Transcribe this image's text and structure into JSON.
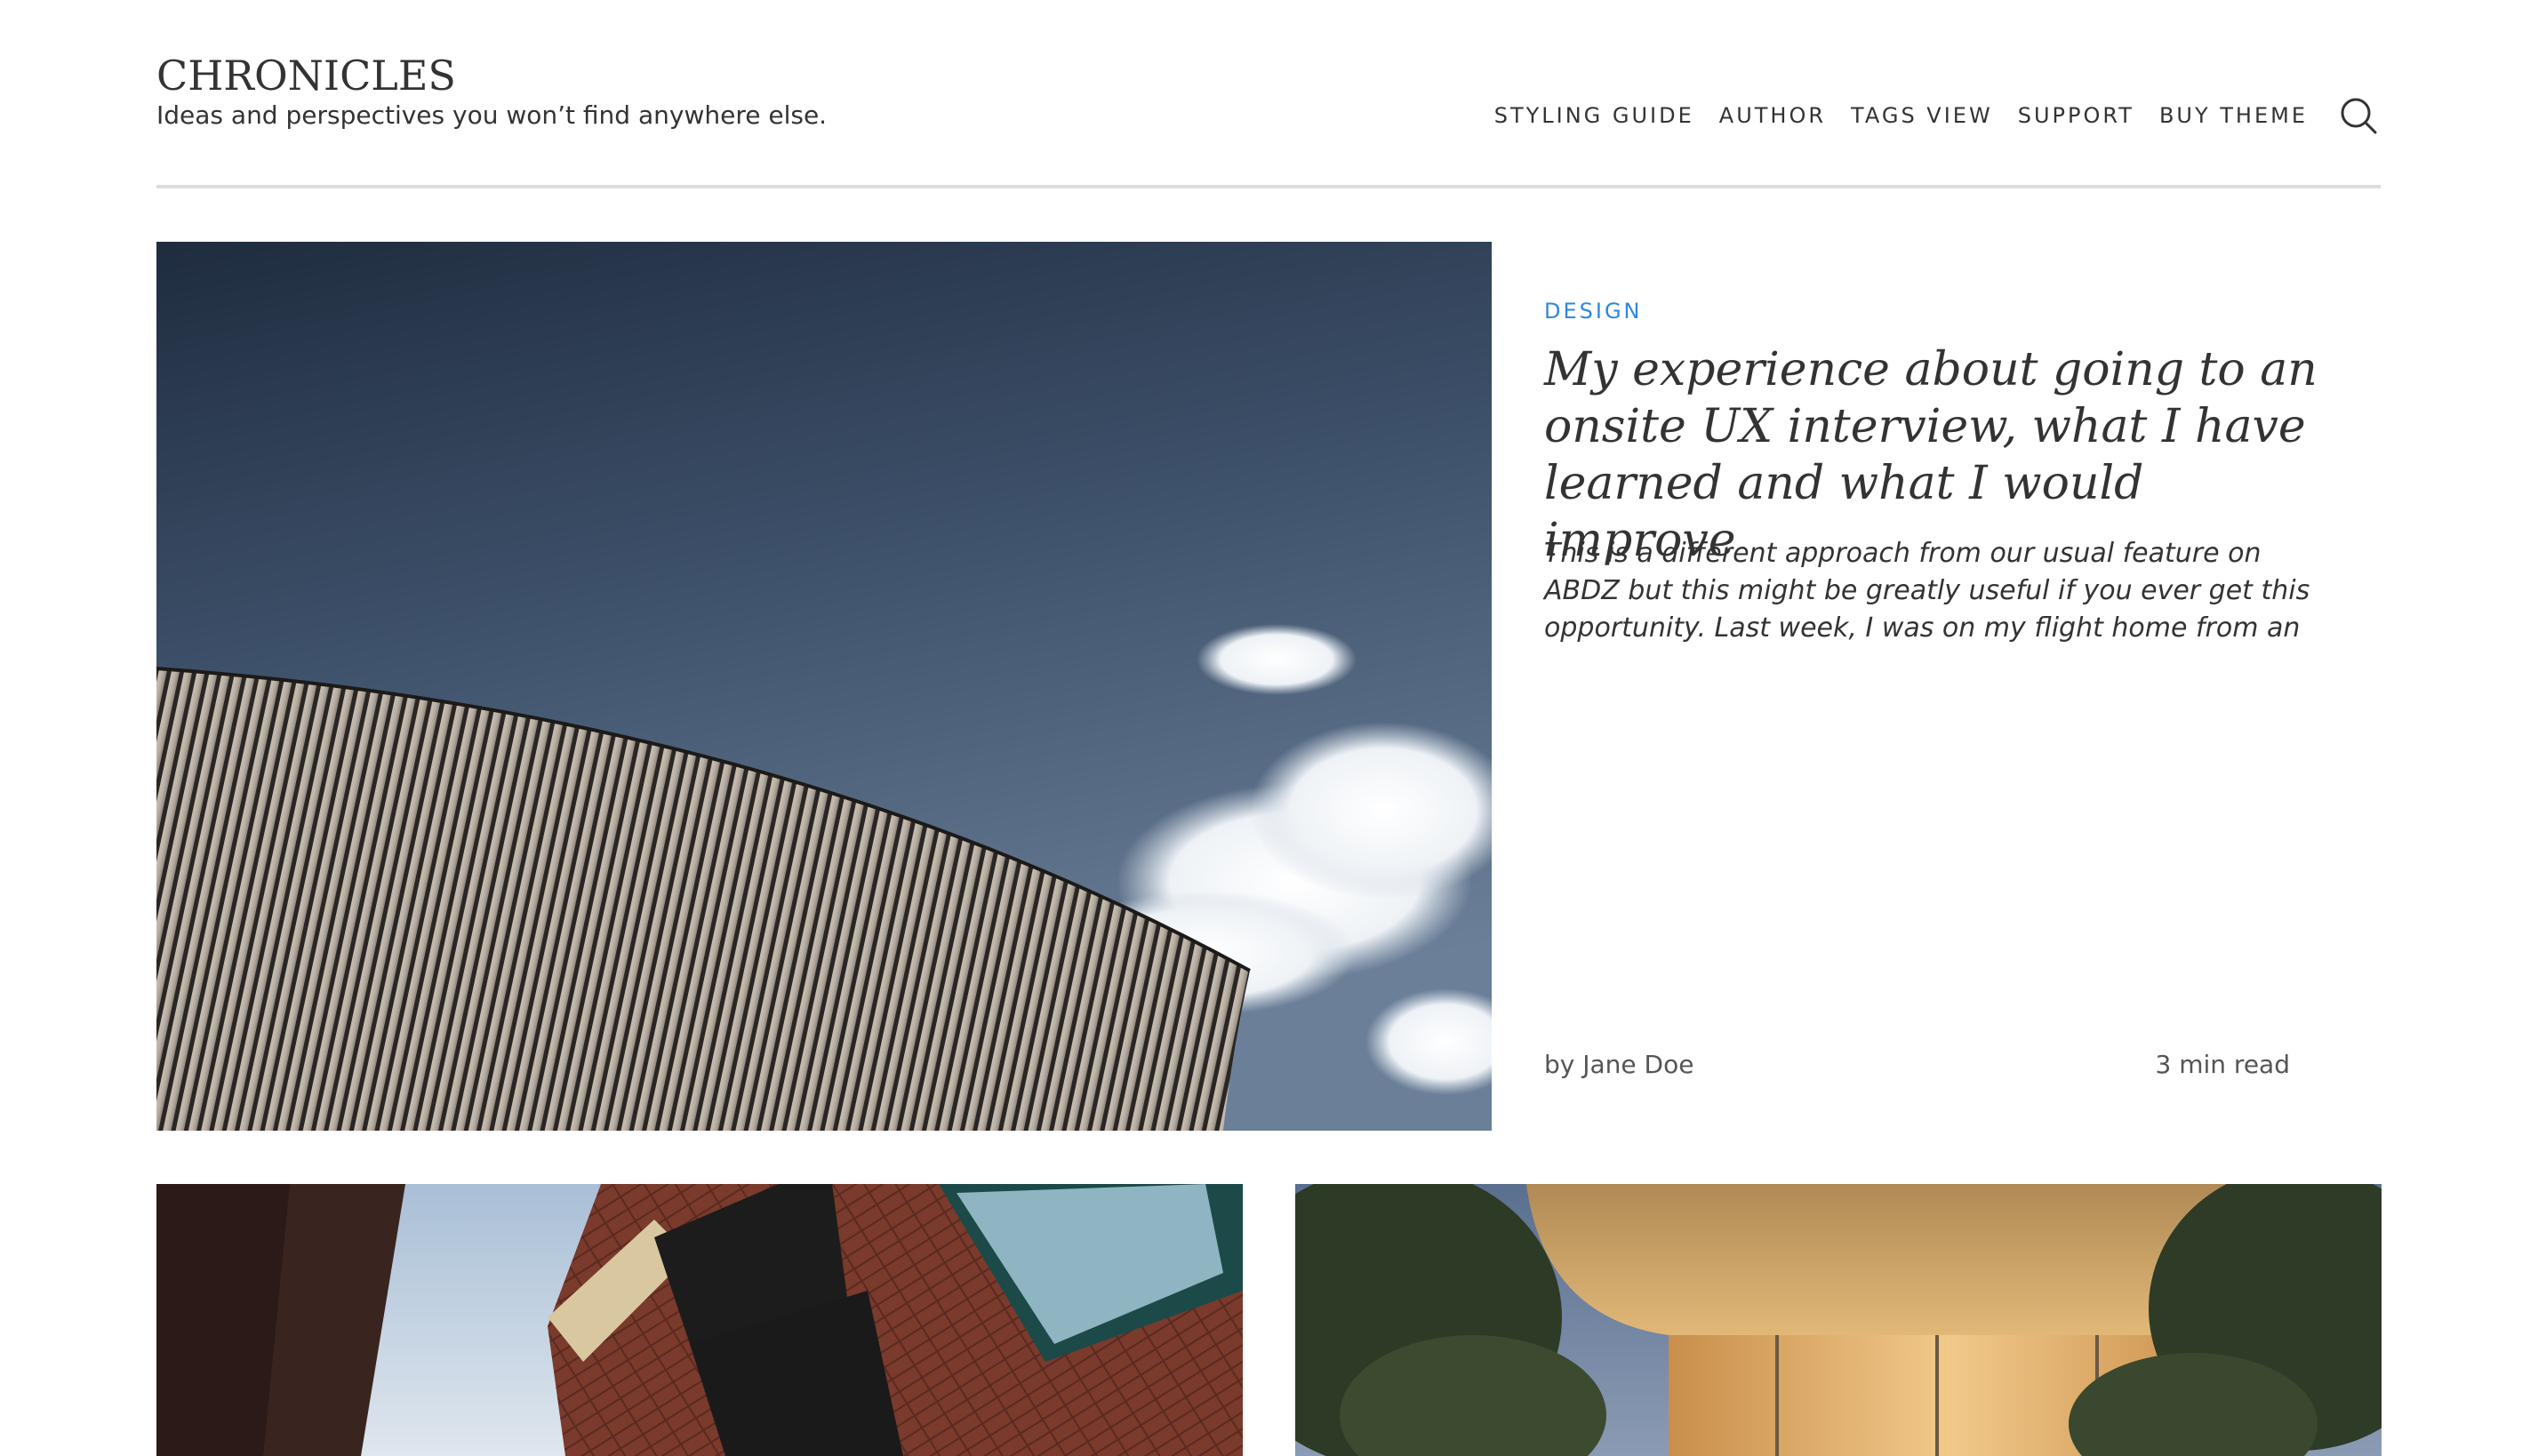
{
  "site": {
    "title": "CHRONICLES",
    "tagline": "Ideas and perspectives you won’t find anywhere else."
  },
  "nav": {
    "items": [
      {
        "label": "STYLING GUIDE"
      },
      {
        "label": "AUTHOR"
      },
      {
        "label": "TAGS VIEW"
      },
      {
        "label": "SUPPORT"
      },
      {
        "label": "BUY THEME"
      }
    ],
    "search_icon": "search-icon"
  },
  "featured": {
    "category": "DESIGN",
    "title": "My experience about going to an onsite UX interview, what I have learned and what I would improve",
    "excerpt": "This is a different approach from our usual feature on ABDZ but this might be greatly useful if you ever get this opportunity. Last week, I was on my flight home from an",
    "byline_prefix": "by ",
    "author": "Jane Doe",
    "read_time": "3 min read"
  },
  "colors": {
    "accent": "#2e87e0",
    "text": "#333333",
    "divider": "#dcdde0"
  }
}
